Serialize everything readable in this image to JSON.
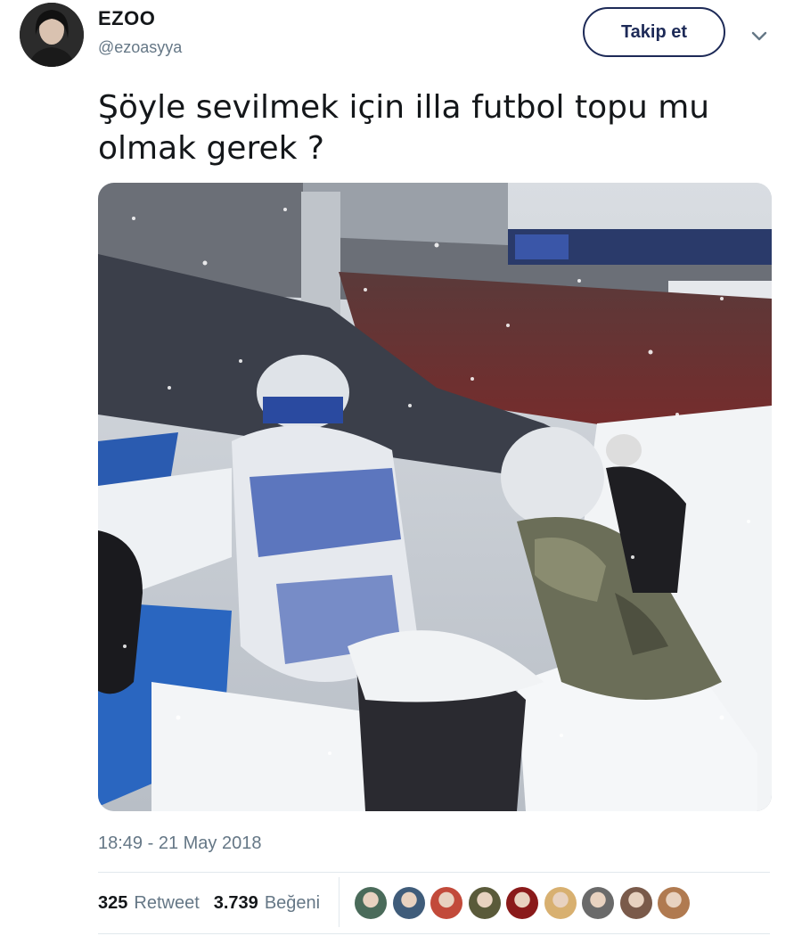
{
  "user": {
    "display_name": "EZOO",
    "handle": "@ezoasyya",
    "avatar_icon": "profile-photo"
  },
  "follow_label": "Takip et",
  "tweet_text_line1": "Şöyle sevilmek için illa futbol topu mu",
  "tweet_text_line2": "olmak gerek ?",
  "timestamp": "18:49 - 21 May 2018",
  "stats": {
    "retweets_count": "325",
    "retweets_label": "Retweet",
    "likes_count": "3.739",
    "likes_label": "Beğeni"
  },
  "likers": [
    {
      "color": "#4a6b5a"
    },
    {
      "color": "#3f5c7a"
    },
    {
      "color": "#c24a3a"
    },
    {
      "color": "#5a5a3a"
    },
    {
      "color": "#8a1a1a"
    },
    {
      "color": "#d8b070"
    },
    {
      "color": "#6a6a6a"
    },
    {
      "color": "#7a5a4a"
    },
    {
      "color": "#b07a50"
    }
  ],
  "colors": {
    "follow_border": "#1d2a57",
    "secondary_text": "#657786",
    "divider": "#e1e8ed"
  }
}
